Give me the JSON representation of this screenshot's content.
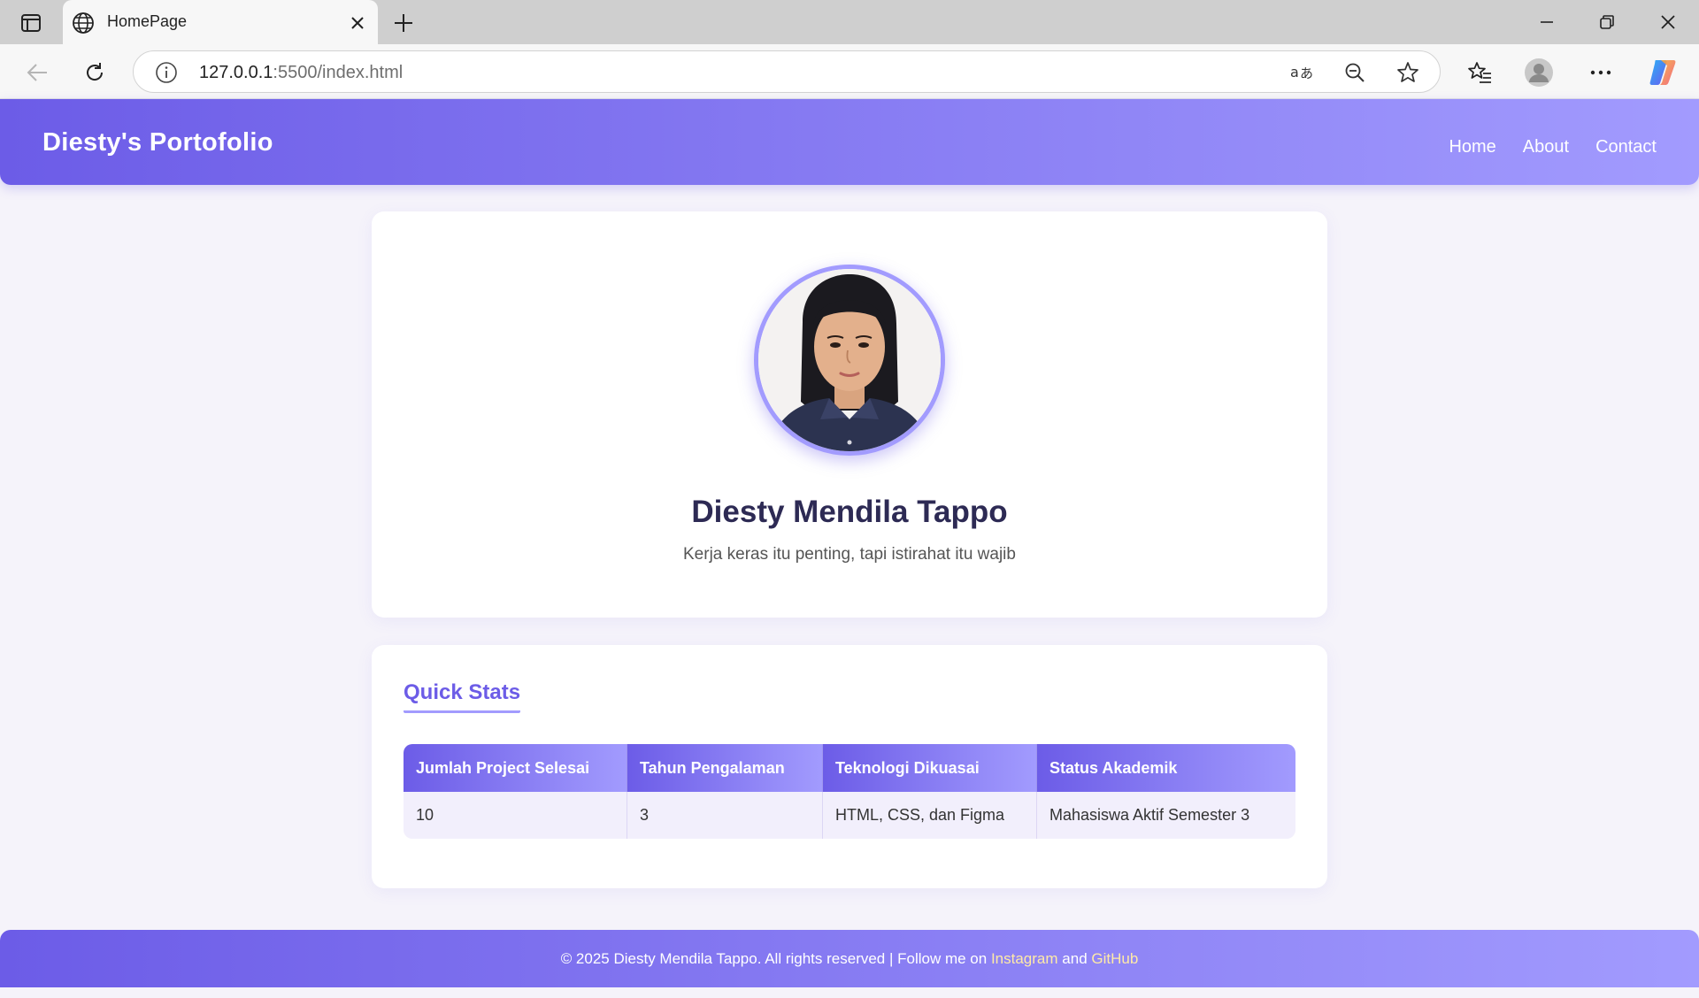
{
  "browser": {
    "tab_title": "HomePage",
    "url_host": "127.0.0.1",
    "url_rest": ":5500/index.html"
  },
  "header": {
    "brand": "Diesty's Portofolio",
    "nav": [
      "Home",
      "About",
      "Contact"
    ]
  },
  "profile": {
    "name": "Diesty Mendila Tappo",
    "tagline": "Kerja keras itu penting, tapi istirahat itu wajib"
  },
  "stats": {
    "title": "Quick Stats",
    "headers": [
      "Jumlah Project Selesai",
      "Tahun Pengalaman",
      "Teknologi Dikuasai",
      "Status Akademik"
    ],
    "values": [
      "10",
      "3",
      "HTML, CSS, dan Figma",
      "Mahasiswa Aktif Semester 3"
    ]
  },
  "footer": {
    "text": "© 2025 Diesty Mendila Tappo. All rights reserved | Follow me on",
    "instagram": "Instagram",
    "and": "and",
    "github": "GitHub"
  },
  "colors": {
    "accent": "#6c5ce7",
    "accent_light": "#a29bfe",
    "page_bg": "#f5f3fa",
    "footer_link": "#ffeaa7"
  }
}
